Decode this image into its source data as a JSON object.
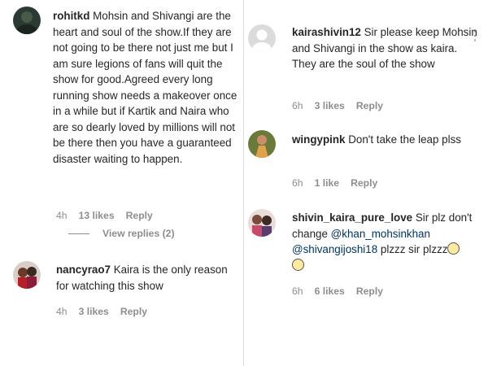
{
  "left": [
    {
      "username": "rohitkd",
      "text": " Mohsin and Shivangi are the heart and soul of the show.If they are not going to be there not just me but I am sure legions of fans will quit the show for good.Agreed every long running show needs a makeover once in a while but if Kartik and Naira who are so dearly loved by millions will not be there then you have a guaranteed disaster waiting to happen.",
      "time": "4h",
      "likes": "13 likes",
      "reply": "Reply",
      "view_replies": "View replies (2)"
    },
    {
      "username": "nancyrao7",
      "text": " Kaira is the only reason for watching this show",
      "time": "4h",
      "likes": "3 likes",
      "reply": "Reply"
    }
  ],
  "right": [
    {
      "username": "kairashivin12",
      "text": " Sir please keep Mohsin and Shivangi in the show as kaira. They are the soul of the show",
      "time": "6h",
      "likes": "3 likes",
      "reply": "Reply",
      "more": "⋮"
    },
    {
      "username": "wingypink",
      "text": " Don't take the leap plss",
      "time": "6h",
      "likes": "1 like",
      "reply": "Reply"
    },
    {
      "username": "shivin_kaira_pure_love",
      "text_a": " Sir plz don't change ",
      "mention1": "@khan_mohsinkhan",
      "mention2": "@shivangijoshi18",
      "text_b": " plzzz sir plzzz",
      "time": "6h",
      "likes": "6 likes",
      "reply": "Reply"
    }
  ],
  "colors": {
    "text": "#262626",
    "meta": "#8e8e8e",
    "mention": "#003569"
  },
  "icons": [
    "avatar-rohitkd",
    "avatar-nancyrao7",
    "avatar-kairashivin12",
    "avatar-wingypink",
    "avatar-shivin-kaira",
    "weary-face-emoji",
    "more-options-icon"
  ]
}
